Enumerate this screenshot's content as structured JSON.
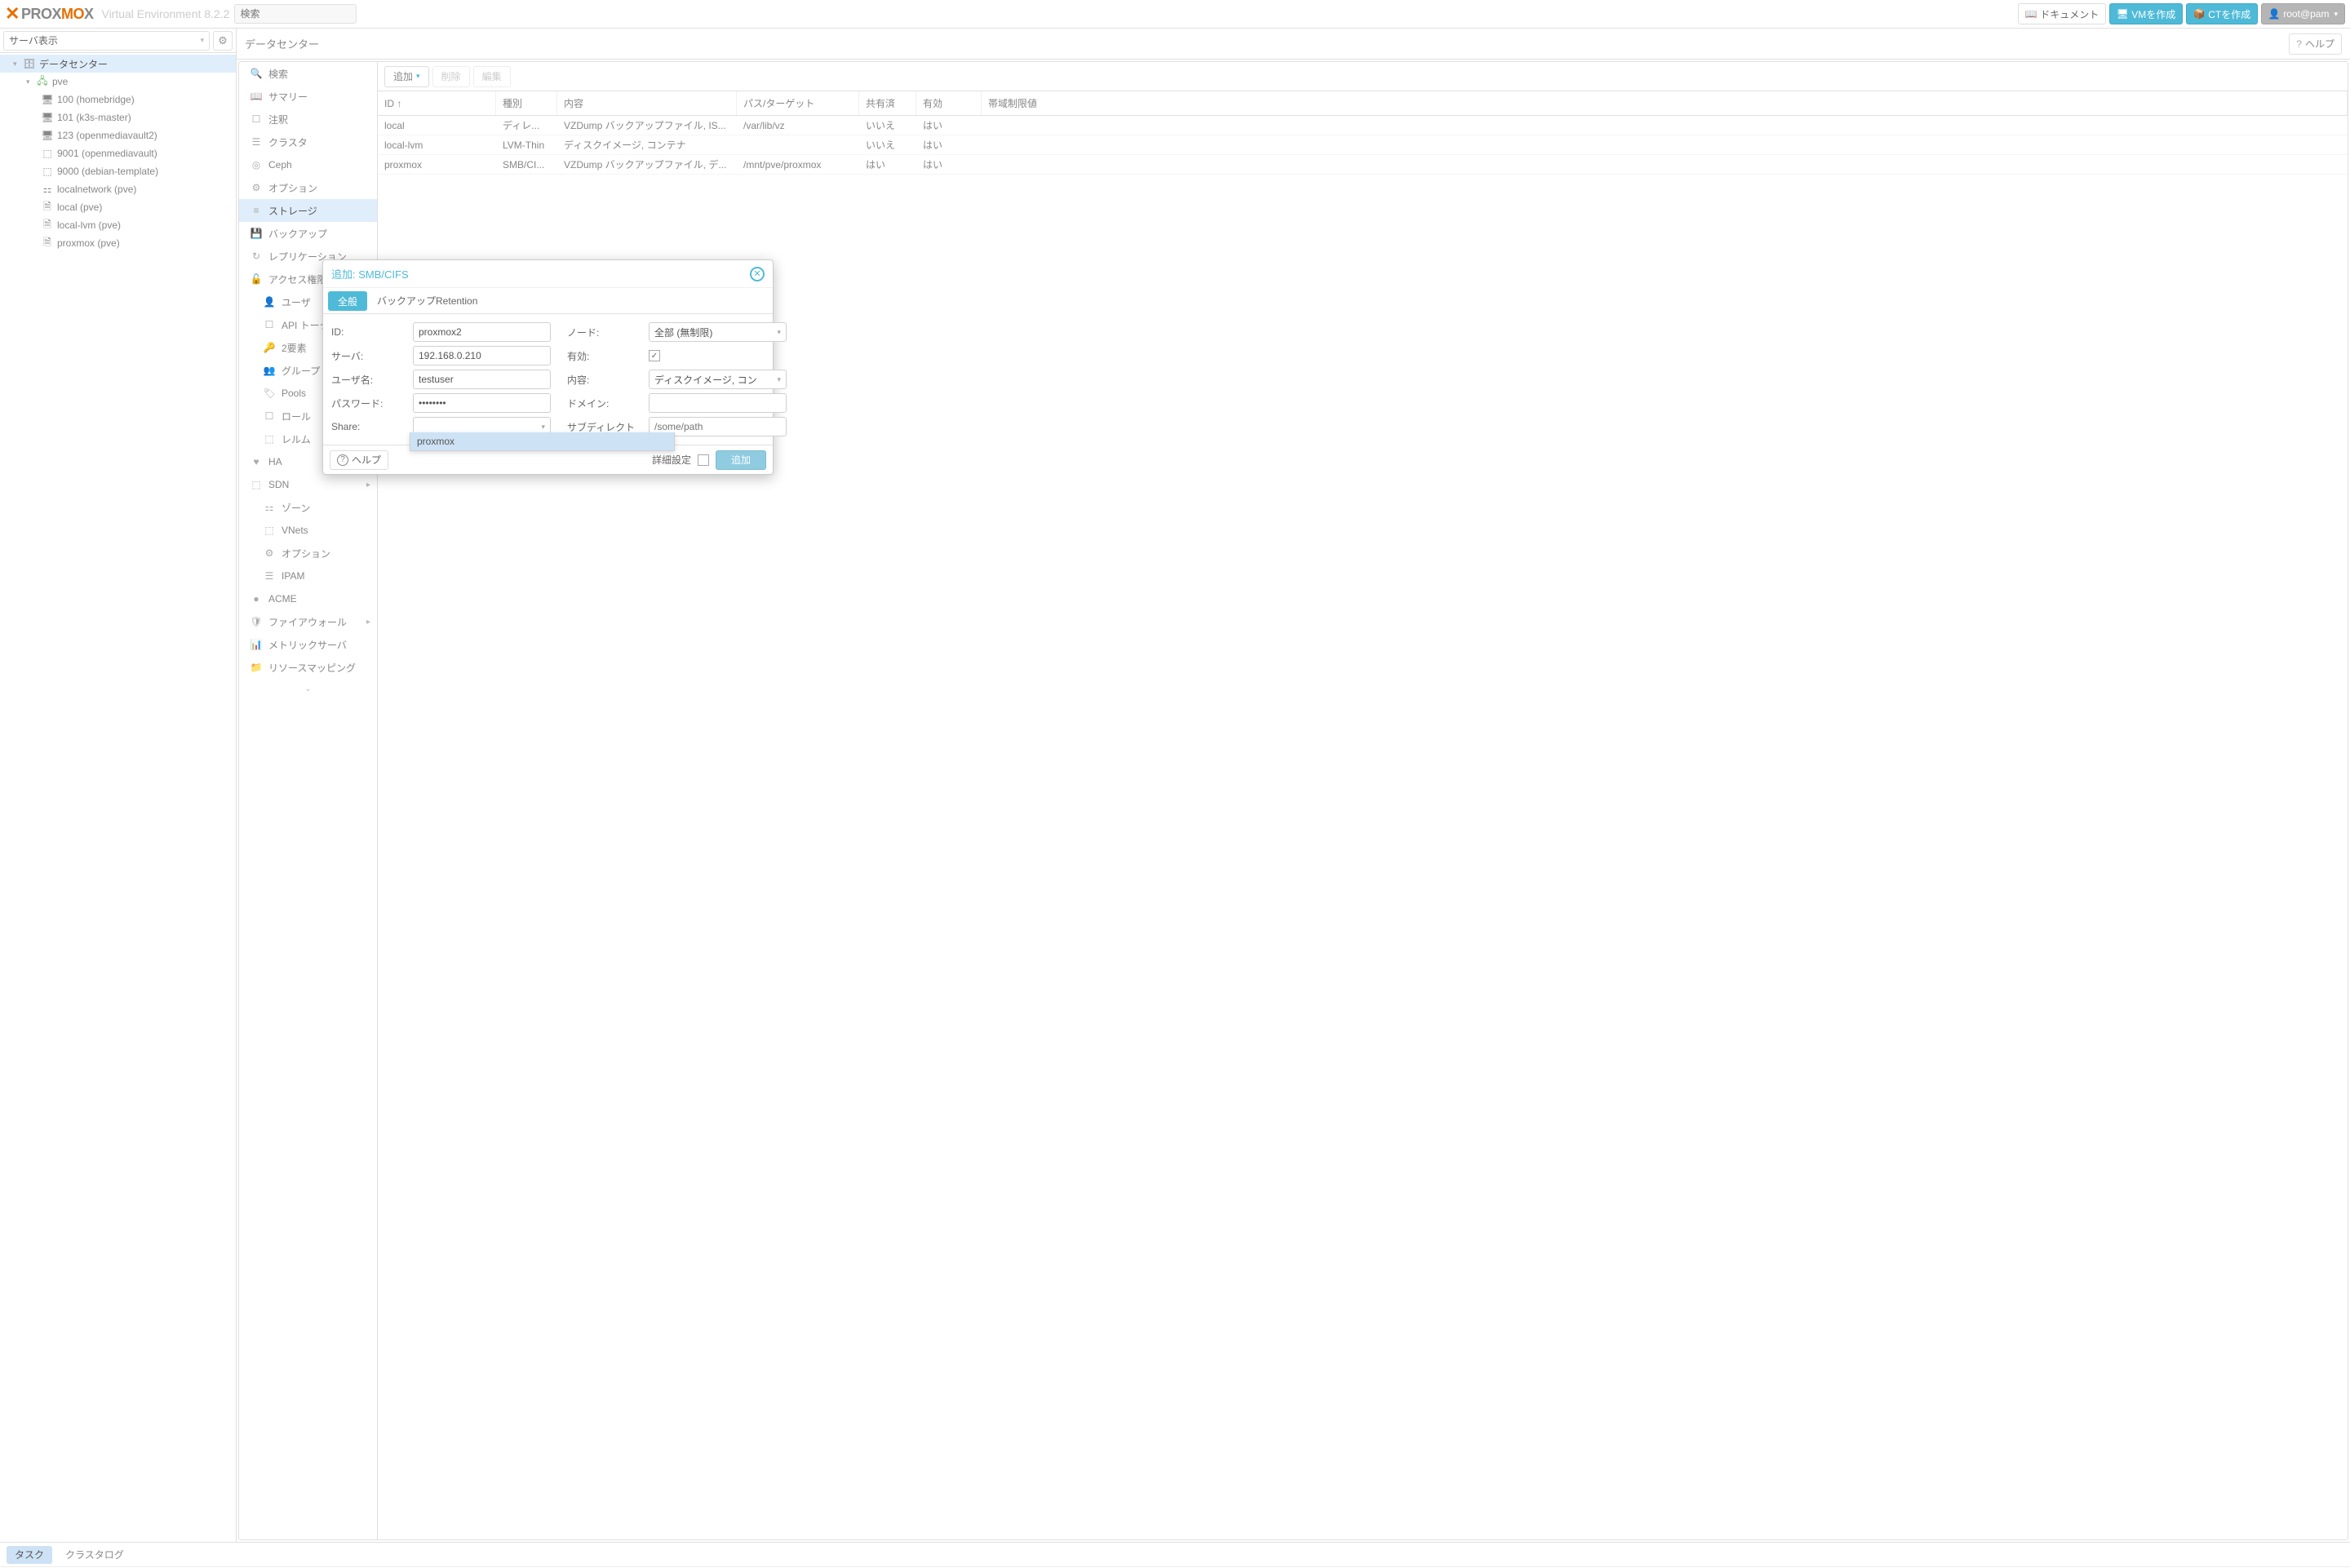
{
  "header": {
    "product": "PROXMOX",
    "ve_label": "Virtual Environment 8.2.2",
    "search_placeholder": "検索",
    "docs_btn": "ドキュメント",
    "create_vm_btn": "VMを作成",
    "create_ct_btn": "CTを作成",
    "user_btn": "root@pam"
  },
  "view_selector": "サーバ表示",
  "tree": {
    "root": "データセンター",
    "node": "pve",
    "items": [
      "100 (homebridge)",
      "101 (k3s-master)",
      "123 (openmediavault2)",
      "9001 (openmediavault)",
      "9000 (debian-template)",
      "localnetwork (pve)",
      "local (pve)",
      "local-lvm (pve)",
      "proxmox (pve)"
    ]
  },
  "breadcrumb": "データセンター",
  "help_label": "ヘルプ",
  "dc_nav": [
    {
      "label": "検索",
      "icon": "search"
    },
    {
      "label": "サマリー",
      "icon": "book"
    },
    {
      "label": "注釈",
      "icon": "note"
    },
    {
      "label": "クラスタ",
      "icon": "cluster"
    },
    {
      "label": "Ceph",
      "icon": "ceph"
    },
    {
      "label": "オプション",
      "icon": "gear"
    },
    {
      "label": "ストレージ",
      "icon": "storage",
      "sel": true
    },
    {
      "label": "バックアップ",
      "icon": "save"
    },
    {
      "label": "レプリケーション",
      "icon": "repl"
    },
    {
      "label": "アクセス権限",
      "icon": "lock",
      "arrow": true
    },
    {
      "label": "ユーザ",
      "icon": "user",
      "sub": true
    },
    {
      "label": "API トークン",
      "icon": "token",
      "sub": true
    },
    {
      "label": "2要素",
      "icon": "key",
      "sub": true
    },
    {
      "label": "グループ",
      "icon": "group",
      "sub": true
    },
    {
      "label": "Pools",
      "icon": "tags",
      "sub": true
    },
    {
      "label": "ロール",
      "icon": "role",
      "sub": true
    },
    {
      "label": "レルム",
      "icon": "realm",
      "sub": true
    },
    {
      "label": "HA",
      "icon": "ha",
      "arrow": true
    },
    {
      "label": "SDN",
      "icon": "sdn",
      "arrow": true
    },
    {
      "label": "ゾーン",
      "icon": "zone",
      "sub": true
    },
    {
      "label": "VNets",
      "icon": "vnet",
      "sub": true
    },
    {
      "label": "オプション",
      "icon": "gear",
      "sub": true
    },
    {
      "label": "IPAM",
      "icon": "ipam",
      "sub": true
    },
    {
      "label": "ACME",
      "icon": "acme"
    },
    {
      "label": "ファイアウォール",
      "icon": "fw",
      "arrow": true
    },
    {
      "label": "メトリックサーバ",
      "icon": "metric"
    },
    {
      "label": "リソースマッピング",
      "icon": "folder"
    }
  ],
  "toolbar": {
    "add": "追加",
    "remove": "削除",
    "edit": "編集"
  },
  "table": {
    "headers": {
      "id": "ID ↑",
      "type": "種別",
      "content": "内容",
      "path": "パス/ターゲット",
      "shared": "共有済",
      "enabled": "有効",
      "bw": "帯域制限値"
    },
    "rows": [
      {
        "id": "local",
        "type": "ディレ...",
        "content": "VZDump バックアップファイル, IS...",
        "path": "/var/lib/vz",
        "shared": "いいえ",
        "enabled": "はい"
      },
      {
        "id": "local-lvm",
        "type": "LVM-Thin",
        "content": "ディスクイメージ, コンテナ",
        "path": "",
        "shared": "いいえ",
        "enabled": "はい"
      },
      {
        "id": "proxmox",
        "type": "SMB/CI...",
        "content": "VZDump バックアップファイル, デ...",
        "path": "/mnt/pve/proxmox",
        "shared": "はい",
        "enabled": "はい"
      }
    ]
  },
  "modal": {
    "title": "追加: SMB/CIFS",
    "tab_general": "全般",
    "tab_retention": "バックアップRetention",
    "labels": {
      "id": "ID:",
      "server": "サーバ:",
      "username": "ユーザ名:",
      "password": "パスワード:",
      "share": "Share:",
      "node": "ノード:",
      "enabled": "有効:",
      "content": "内容:",
      "domain": "ドメイン:",
      "subdir": "サブディレクト"
    },
    "values": {
      "id": "proxmox2",
      "server": "192.168.0.210",
      "username": "testuser",
      "password": "••••••••",
      "node": "全部 (無制限)",
      "content": "ディスクイメージ, コン",
      "subdir_placeholder": "/some/path"
    },
    "dropdown_option": "proxmox",
    "footer": {
      "help": "ヘルプ",
      "advanced": "詳細設定",
      "submit": "追加"
    }
  },
  "bottom": {
    "task": "タスク",
    "cluster_log": "クラスタログ"
  }
}
